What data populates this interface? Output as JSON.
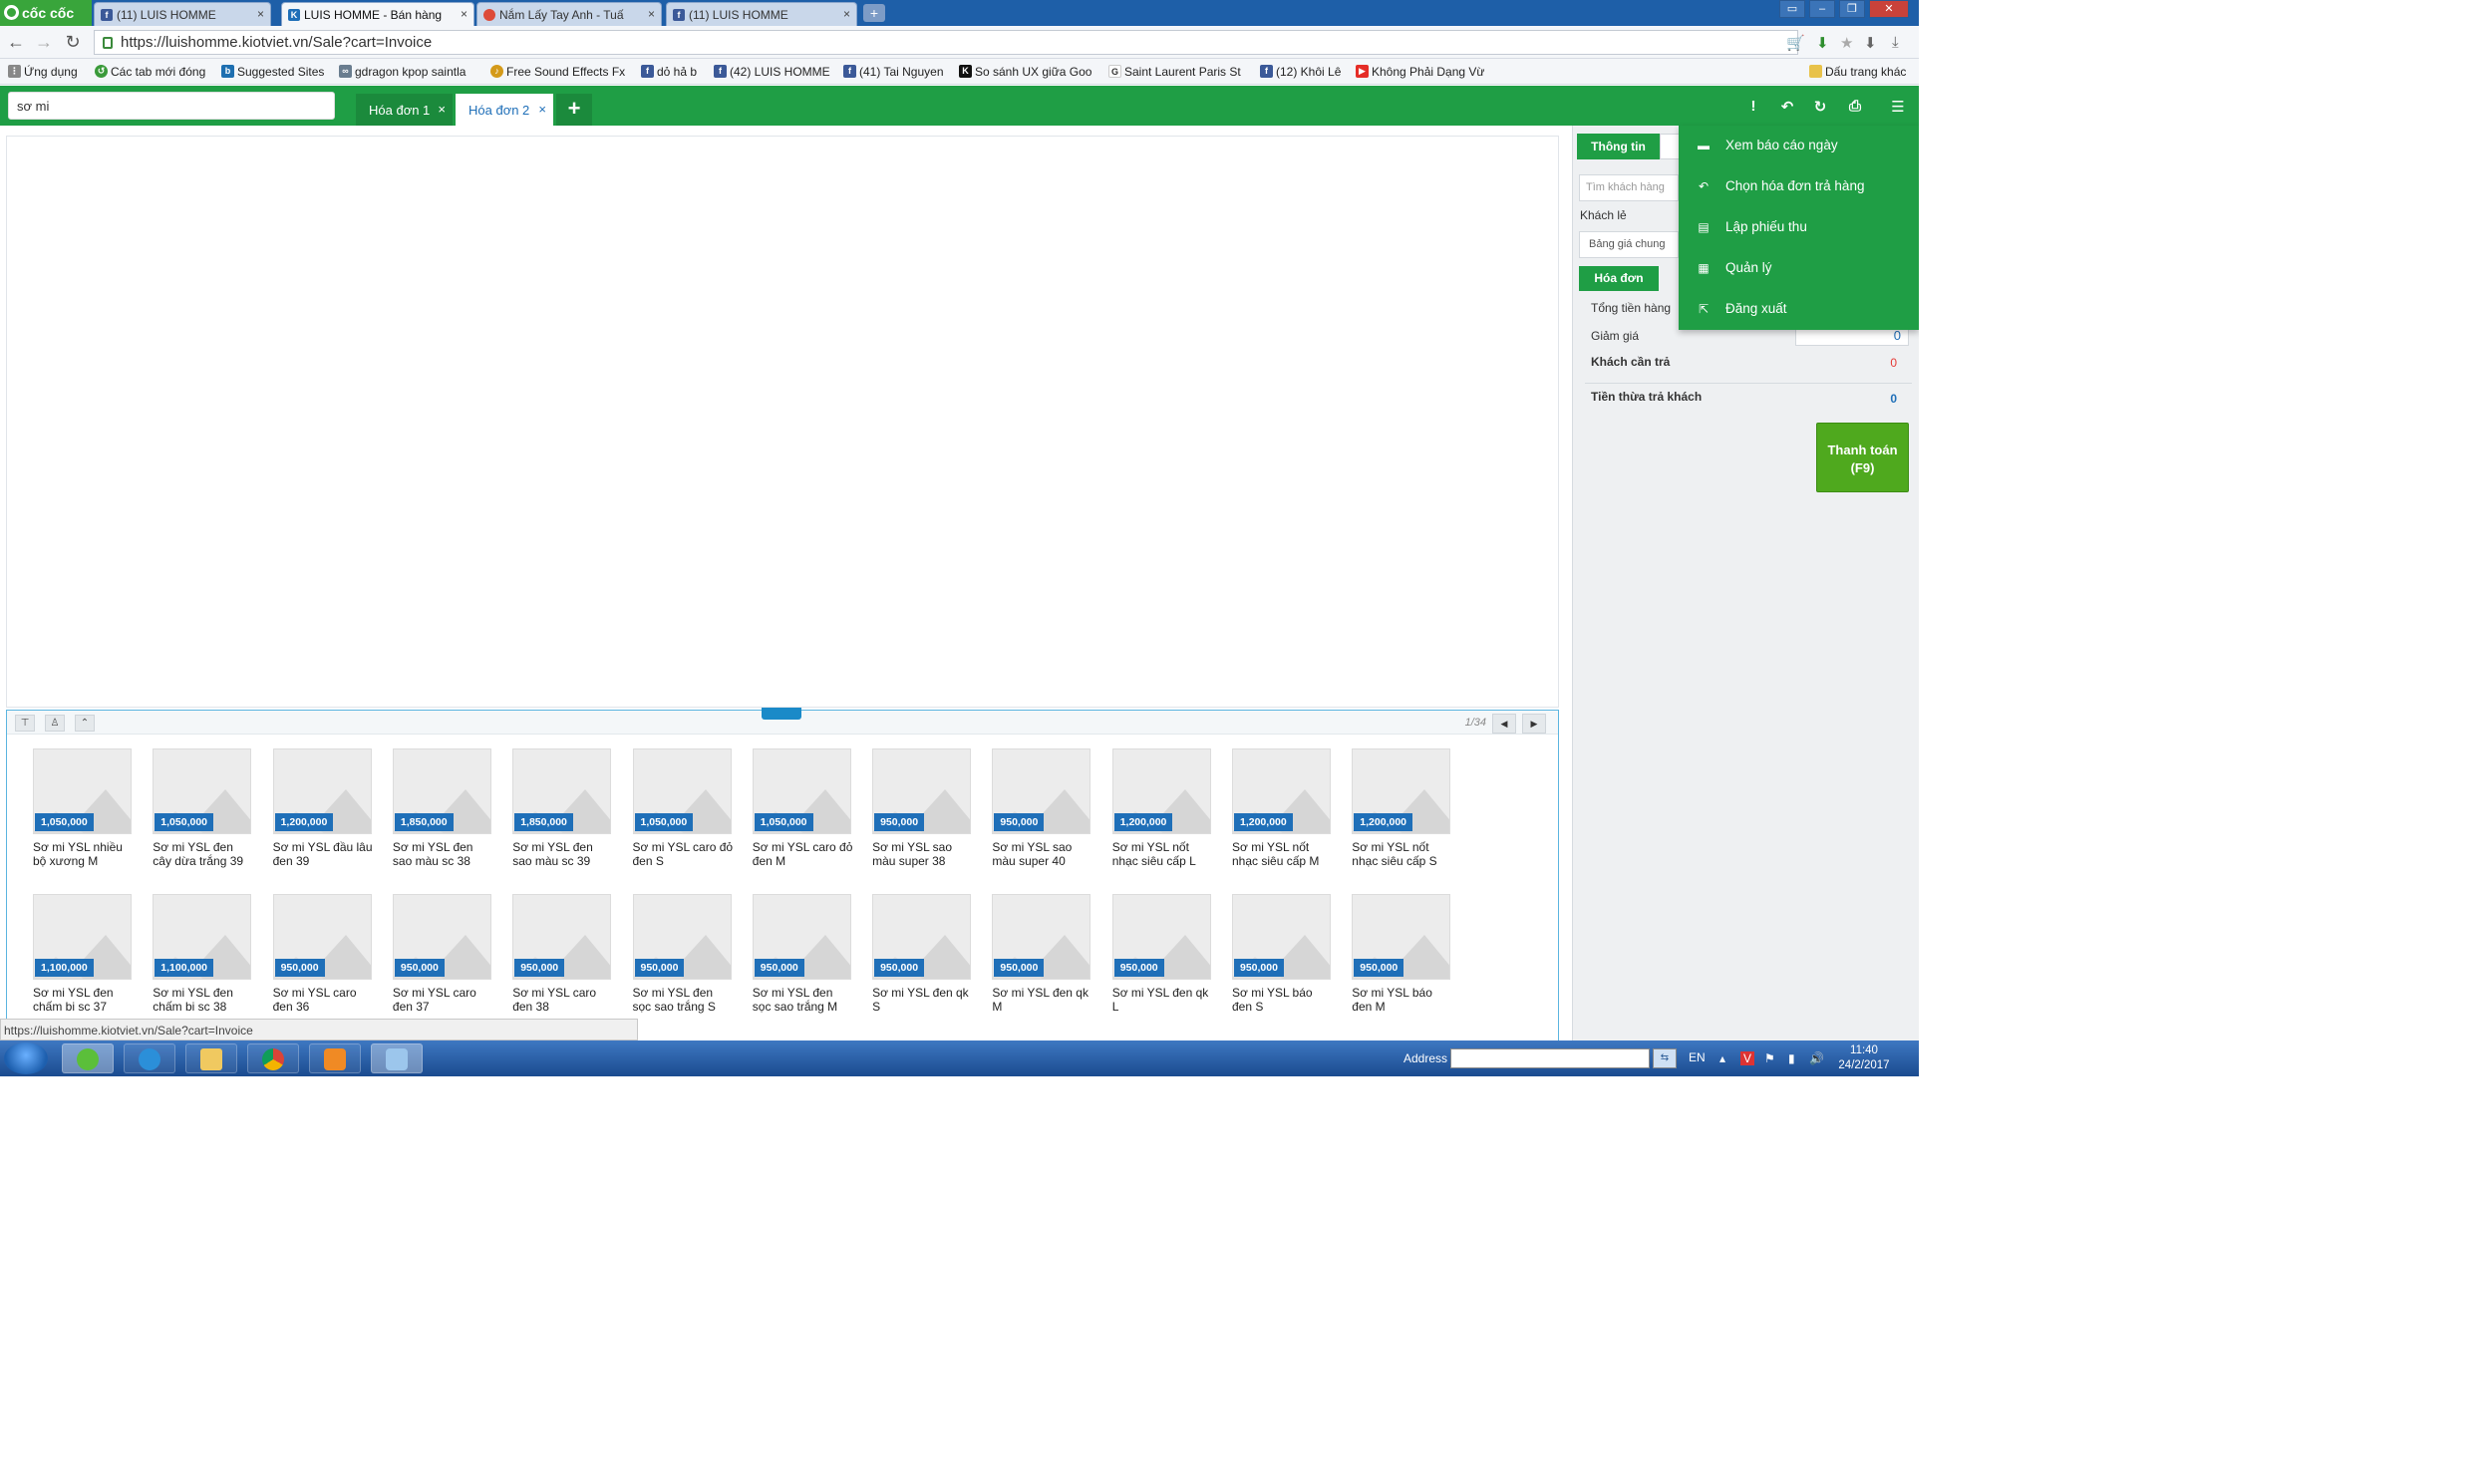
{
  "browser": {
    "brand": "cốc cốc",
    "tabs": [
      {
        "label": "(11) LUIS HOMME",
        "icon": "facebook-icon"
      },
      {
        "label": "LUIS HOMME - Bán hàng",
        "icon": "kiotviet-icon"
      },
      {
        "label": "Nắm Lấy Tay Anh - Tuấ",
        "icon": "chrome-icon"
      },
      {
        "label": "(11) LUIS HOMME",
        "icon": "facebook-icon"
      }
    ],
    "url": "https://luishomme.kiotviet.vn/Sale?cart=Invoice",
    "bookmarks": [
      {
        "label": "Ứng dụng",
        "icon": "apps-icon"
      },
      {
        "label": "Các tab mới đóng",
        "icon": "history-icon"
      },
      {
        "label": "Suggested Sites",
        "icon": "bing-icon"
      },
      {
        "label": "gdragon kpop saintla",
        "icon": "site-icon"
      },
      {
        "label": "Free Sound Effects Fx",
        "icon": "site-icon"
      },
      {
        "label": "dỏ hả b",
        "icon": "facebook-icon"
      },
      {
        "label": "(42) LUIS HOMME",
        "icon": "facebook-icon"
      },
      {
        "label": "(41) Tai Nguyen",
        "icon": "facebook-icon"
      },
      {
        "label": "So sánh UX giữa Goo",
        "icon": "site-icon"
      },
      {
        "label": "Saint Laurent Paris St",
        "icon": "google-icon"
      },
      {
        "label": "(12) Khôi Lê",
        "icon": "facebook-icon"
      },
      {
        "label": "Không Phải Dạng Vừ",
        "icon": "youtube-icon"
      }
    ],
    "other_bookmarks": "Dấu trang khác",
    "status_url": "https://luishomme.kiotviet.vn/Sale?cart=Invoice"
  },
  "app": {
    "search_value": "sơ mi",
    "invoice_tabs": [
      {
        "label": "Hóa đơn 1",
        "active": false
      },
      {
        "label": "Hóa đơn 2",
        "active": true
      }
    ],
    "add_tab": "+",
    "header_icons": [
      "alert-icon",
      "undo-icon",
      "refresh-icon",
      "print-icon",
      "menu-icon"
    ]
  },
  "menu": {
    "items": [
      {
        "label": "Xem báo cáo ngày",
        "icon": "report-icon"
      },
      {
        "label": "Chọn hóa đơn trả hàng",
        "icon": "return-icon"
      },
      {
        "label": "Lập phiếu thu",
        "icon": "receipt-icon"
      },
      {
        "label": "Quản lý",
        "icon": "manage-icon"
      },
      {
        "label": "Đăng xuất",
        "icon": "logout-icon"
      }
    ]
  },
  "products": {
    "pager": "1/34",
    "items": [
      {
        "price": "1,050,000",
        "name": "Sơ mi YSL nhiều bộ xương M"
      },
      {
        "price": "1,050,000",
        "name": "Sơ mi YSL đen cây dừa trắng 39"
      },
      {
        "price": "1,200,000",
        "name": "Sơ mi YSL đầu lâu đen 39"
      },
      {
        "price": "1,850,000",
        "name": "Sơ mi YSL đen sao màu sc 38"
      },
      {
        "price": "1,850,000",
        "name": "Sơ mi YSL đen sao màu sc 39"
      },
      {
        "price": "1,050,000",
        "name": "Sơ mi YSL caro đỏ đen S"
      },
      {
        "price": "1,050,000",
        "name": "Sơ mi YSL caro đỏ đen M"
      },
      {
        "price": "950,000",
        "name": "Sơ mi YSL sao màu super 38"
      },
      {
        "price": "950,000",
        "name": "Sơ mi YSL sao màu super 40"
      },
      {
        "price": "1,200,000",
        "name": "Sơ mi YSL nốt nhạc siêu cấp L"
      },
      {
        "price": "1,200,000",
        "name": "Sơ mi YSL nốt nhạc siêu cấp M"
      },
      {
        "price": "1,200,000",
        "name": "Sơ mi YSL nốt nhạc siêu cấp S"
      },
      {
        "price": "1,100,000",
        "name": "Sơ mi YSL đen chấm bi sc 37"
      },
      {
        "price": "1,100,000",
        "name": "Sơ mi YSL đen chấm bi sc 38"
      },
      {
        "price": "950,000",
        "name": "Sơ mi YSL caro đen 36"
      },
      {
        "price": "950,000",
        "name": "Sơ mi YSL caro đen 37"
      },
      {
        "price": "950,000",
        "name": "Sơ mi YSL caro đen 38"
      },
      {
        "price": "950,000",
        "name": "Sơ mi YSL đen sọc sao trắng S"
      },
      {
        "price": "950,000",
        "name": "Sơ mi YSL đen sọc sao trắng M"
      },
      {
        "price": "950,000",
        "name": "Sơ mi YSL đen qk S"
      },
      {
        "price": "950,000",
        "name": "Sơ mi YSL đen qk M"
      },
      {
        "price": "950,000",
        "name": "Sơ mi YSL đen qk L"
      },
      {
        "price": "950,000",
        "name": "Sơ mi YSL báo đen S"
      },
      {
        "price": "950,000",
        "name": "Sơ mi YSL báo đen M"
      }
    ]
  },
  "panel": {
    "info_tab": "Thông tin",
    "customer_placeholder": "Tìm khách hàng",
    "customer_label": "Khách lẻ",
    "pricelist": "Bảng giá chung",
    "invoice_tab": "Hóa đơn",
    "total_label": "Tổng tiền hàng",
    "discount_label": "Giảm giá",
    "discount_value": "0",
    "due_label": "Khách cần trả",
    "due_value": "0",
    "change_label": "Tiền thừa trả khách",
    "change_value": "0",
    "pay_button": "Thanh toán\n(F9)"
  },
  "taskbar": {
    "address_label": "Address",
    "lang": "EN",
    "time": "11:40",
    "date": "24/2/2017"
  },
  "colors": {
    "brand_green": "#1f9e45",
    "accent_blue": "#1f6fb8",
    "due_red": "#e53935",
    "pay_green": "#4fa91e"
  }
}
